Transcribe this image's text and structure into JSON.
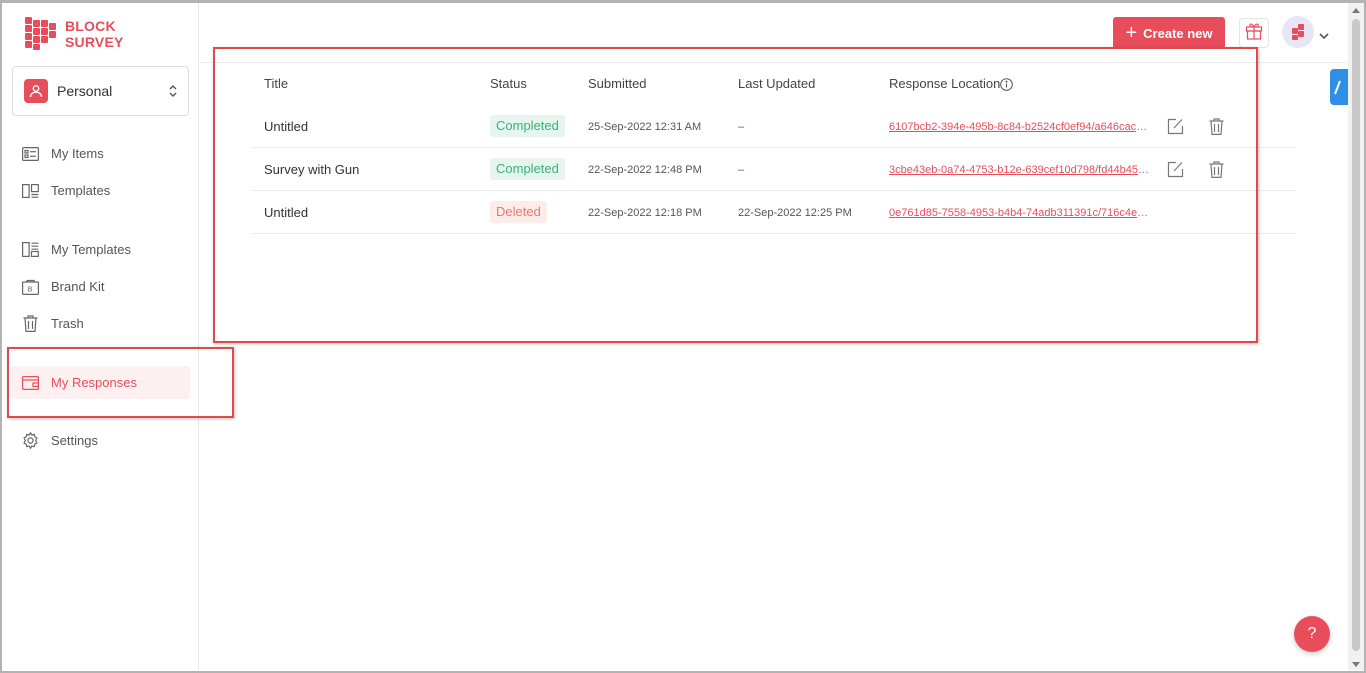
{
  "brand": {
    "line1": "BLOCK",
    "line2": "SURVEY"
  },
  "workspace": {
    "label": "Personal"
  },
  "sidebar": {
    "items": [
      {
        "label": "My Items"
      },
      {
        "label": "Templates"
      },
      {
        "label": "My Templates"
      },
      {
        "label": "Brand Kit"
      },
      {
        "label": "Trash"
      },
      {
        "label": "My Responses"
      },
      {
        "label": "Settings"
      }
    ],
    "active": "My Responses"
  },
  "header": {
    "create_label": "Create new"
  },
  "table": {
    "columns": [
      "Title",
      "Status",
      "Submitted",
      "Last Updated",
      "Response Location"
    ],
    "rows": [
      {
        "title": "Untitled",
        "status": "Completed",
        "submitted": "25-Sep-2022 12:31 AM",
        "updated": "–",
        "location": "6107bcb2-394e-495b-8c84-b2524cf0ef94/a646cac1-8..."
      },
      {
        "title": "Survey with Gun",
        "status": "Completed",
        "submitted": "22-Sep-2022 12:48 PM",
        "updated": "–",
        "location": "3cbe43eb-0a74-4753-b12e-639cef10d798/fd44b450-..."
      },
      {
        "title": "Untitled",
        "status": "Deleted",
        "submitted": "22-Sep-2022 12:18 PM",
        "updated": "22-Sep-2022 12:25 PM",
        "location": "0e761d85-7558-4953-b4b4-74adb311391c/716c4e88..."
      }
    ]
  },
  "help": {
    "label": "?"
  },
  "colors": {
    "accent": "#e84d5b",
    "completed": "#3bb07a",
    "deleted": "#ea7a6a",
    "highlight": "#e04a4a"
  }
}
